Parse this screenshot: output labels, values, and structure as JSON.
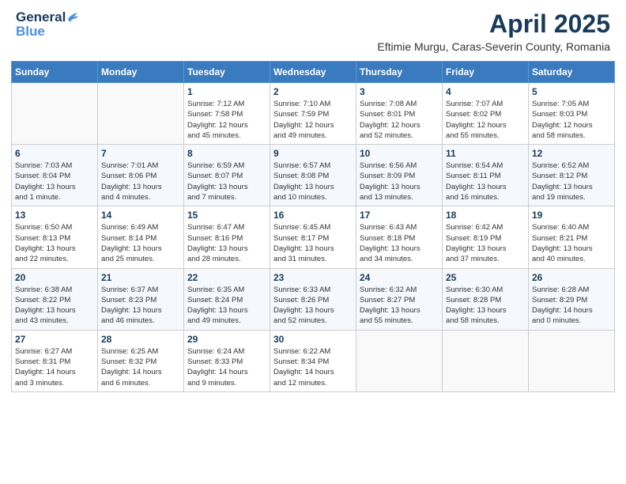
{
  "header": {
    "logo_line1": "General",
    "logo_line2": "Blue",
    "title": "April 2025",
    "subtitle": "Eftimie Murgu, Caras-Severin County, Romania"
  },
  "days_of_week": [
    "Sunday",
    "Monday",
    "Tuesday",
    "Wednesday",
    "Thursday",
    "Friday",
    "Saturday"
  ],
  "weeks": [
    [
      {
        "num": "",
        "info": ""
      },
      {
        "num": "",
        "info": ""
      },
      {
        "num": "1",
        "info": "Sunrise: 7:12 AM\nSunset: 7:58 PM\nDaylight: 12 hours\nand 45 minutes."
      },
      {
        "num": "2",
        "info": "Sunrise: 7:10 AM\nSunset: 7:59 PM\nDaylight: 12 hours\nand 49 minutes."
      },
      {
        "num": "3",
        "info": "Sunrise: 7:08 AM\nSunset: 8:01 PM\nDaylight: 12 hours\nand 52 minutes."
      },
      {
        "num": "4",
        "info": "Sunrise: 7:07 AM\nSunset: 8:02 PM\nDaylight: 12 hours\nand 55 minutes."
      },
      {
        "num": "5",
        "info": "Sunrise: 7:05 AM\nSunset: 8:03 PM\nDaylight: 12 hours\nand 58 minutes."
      }
    ],
    [
      {
        "num": "6",
        "info": "Sunrise: 7:03 AM\nSunset: 8:04 PM\nDaylight: 13 hours\nand 1 minute."
      },
      {
        "num": "7",
        "info": "Sunrise: 7:01 AM\nSunset: 8:06 PM\nDaylight: 13 hours\nand 4 minutes."
      },
      {
        "num": "8",
        "info": "Sunrise: 6:59 AM\nSunset: 8:07 PM\nDaylight: 13 hours\nand 7 minutes."
      },
      {
        "num": "9",
        "info": "Sunrise: 6:57 AM\nSunset: 8:08 PM\nDaylight: 13 hours\nand 10 minutes."
      },
      {
        "num": "10",
        "info": "Sunrise: 6:56 AM\nSunset: 8:09 PM\nDaylight: 13 hours\nand 13 minutes."
      },
      {
        "num": "11",
        "info": "Sunrise: 6:54 AM\nSunset: 8:11 PM\nDaylight: 13 hours\nand 16 minutes."
      },
      {
        "num": "12",
        "info": "Sunrise: 6:52 AM\nSunset: 8:12 PM\nDaylight: 13 hours\nand 19 minutes."
      }
    ],
    [
      {
        "num": "13",
        "info": "Sunrise: 6:50 AM\nSunset: 8:13 PM\nDaylight: 13 hours\nand 22 minutes."
      },
      {
        "num": "14",
        "info": "Sunrise: 6:49 AM\nSunset: 8:14 PM\nDaylight: 13 hours\nand 25 minutes."
      },
      {
        "num": "15",
        "info": "Sunrise: 6:47 AM\nSunset: 8:16 PM\nDaylight: 13 hours\nand 28 minutes."
      },
      {
        "num": "16",
        "info": "Sunrise: 6:45 AM\nSunset: 8:17 PM\nDaylight: 13 hours\nand 31 minutes."
      },
      {
        "num": "17",
        "info": "Sunrise: 6:43 AM\nSunset: 8:18 PM\nDaylight: 13 hours\nand 34 minutes."
      },
      {
        "num": "18",
        "info": "Sunrise: 6:42 AM\nSunset: 8:19 PM\nDaylight: 13 hours\nand 37 minutes."
      },
      {
        "num": "19",
        "info": "Sunrise: 6:40 AM\nSunset: 8:21 PM\nDaylight: 13 hours\nand 40 minutes."
      }
    ],
    [
      {
        "num": "20",
        "info": "Sunrise: 6:38 AM\nSunset: 8:22 PM\nDaylight: 13 hours\nand 43 minutes."
      },
      {
        "num": "21",
        "info": "Sunrise: 6:37 AM\nSunset: 8:23 PM\nDaylight: 13 hours\nand 46 minutes."
      },
      {
        "num": "22",
        "info": "Sunrise: 6:35 AM\nSunset: 8:24 PM\nDaylight: 13 hours\nand 49 minutes."
      },
      {
        "num": "23",
        "info": "Sunrise: 6:33 AM\nSunset: 8:26 PM\nDaylight: 13 hours\nand 52 minutes."
      },
      {
        "num": "24",
        "info": "Sunrise: 6:32 AM\nSunset: 8:27 PM\nDaylight: 13 hours\nand 55 minutes."
      },
      {
        "num": "25",
        "info": "Sunrise: 6:30 AM\nSunset: 8:28 PM\nDaylight: 13 hours\nand 58 minutes."
      },
      {
        "num": "26",
        "info": "Sunrise: 6:28 AM\nSunset: 8:29 PM\nDaylight: 14 hours\nand 0 minutes."
      }
    ],
    [
      {
        "num": "27",
        "info": "Sunrise: 6:27 AM\nSunset: 8:31 PM\nDaylight: 14 hours\nand 3 minutes."
      },
      {
        "num": "28",
        "info": "Sunrise: 6:25 AM\nSunset: 8:32 PM\nDaylight: 14 hours\nand 6 minutes."
      },
      {
        "num": "29",
        "info": "Sunrise: 6:24 AM\nSunset: 8:33 PM\nDaylight: 14 hours\nand 9 minutes."
      },
      {
        "num": "30",
        "info": "Sunrise: 6:22 AM\nSunset: 8:34 PM\nDaylight: 14 hours\nand 12 minutes."
      },
      {
        "num": "",
        "info": ""
      },
      {
        "num": "",
        "info": ""
      },
      {
        "num": "",
        "info": ""
      }
    ]
  ]
}
